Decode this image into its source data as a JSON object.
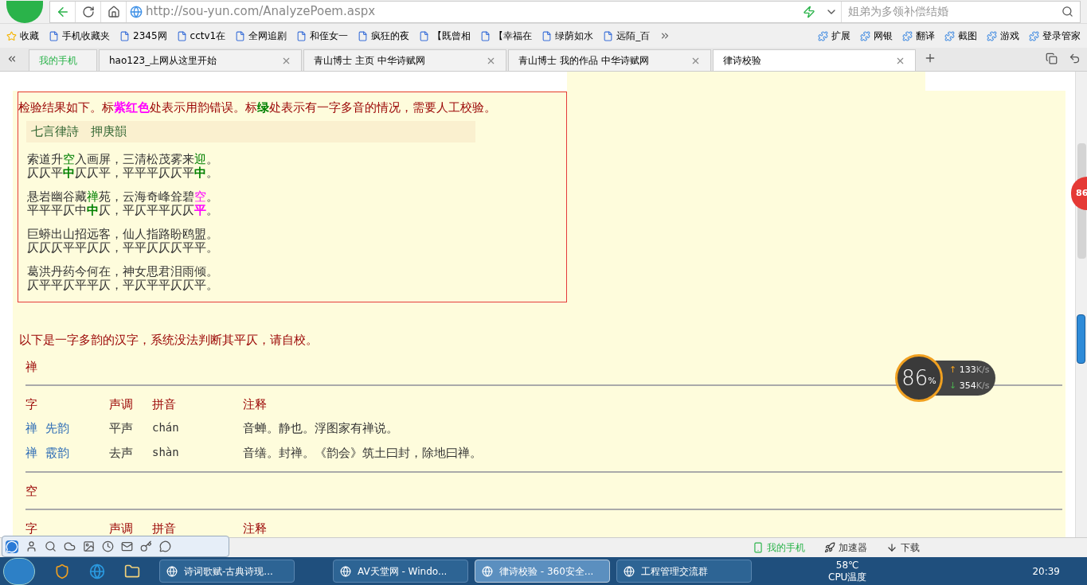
{
  "browser": {
    "url": "http://sou-yun.com/AnalyzePoem.aspx",
    "search_placeholder": "姐弟为多领补偿结婚",
    "bookmarks": [
      {
        "label": "收藏"
      },
      {
        "label": "手机收藏夹"
      },
      {
        "label": "2345网"
      },
      {
        "label": "cctv1在"
      },
      {
        "label": "全网追剧"
      },
      {
        "label": "和侄女一"
      },
      {
        "label": "疯狂的夜"
      },
      {
        "label": "【既曾相"
      },
      {
        "label": "【幸福在"
      },
      {
        "label": "绿荫如水"
      },
      {
        "label": "远陌_百"
      }
    ],
    "tools": [
      {
        "label": "扩展"
      },
      {
        "label": "网银"
      },
      {
        "label": "翻译"
      },
      {
        "label": "截图"
      },
      {
        "label": "游戏"
      },
      {
        "label": "登录管家"
      }
    ],
    "tabs": [
      {
        "label": "我的手机",
        "selected": false
      },
      {
        "label": "hao123_上网从这里开始",
        "selected": false
      },
      {
        "label": "青山博士 主页 中华诗赋网",
        "selected": false
      },
      {
        "label": "青山博士 我的作品 中华诗赋网",
        "selected": false
      },
      {
        "label": "律诗校验",
        "selected": true
      }
    ]
  },
  "result": {
    "intro": [
      {
        "text": "检验结果如下。标",
        "kind": "plain"
      },
      {
        "text": "紫红色",
        "kind": "error"
      },
      {
        "text": "处表示用韵错误。标",
        "kind": "plain"
      },
      {
        "text": "绿",
        "kind": "multi"
      },
      {
        "text": "处表示有一字多音的情况，需要人工校验。",
        "kind": "plain"
      }
    ],
    "form": "七言律詩　押庚韻",
    "couplets": [
      {
        "verse": [
          {
            "text": "索道升",
            "kind": "plain"
          },
          {
            "text": "空",
            "kind": "multi"
          },
          {
            "text": "入画屏，三清松茂雾来",
            "kind": "plain"
          },
          {
            "text": "迎",
            "kind": "multi"
          },
          {
            "text": "。",
            "kind": "plain"
          }
        ],
        "tones": [
          {
            "text": "仄仄平",
            "kind": "plain"
          },
          {
            "text": "中",
            "kind": "multi"
          },
          {
            "text": "仄仄平，平平平仄仄平",
            "kind": "plain"
          },
          {
            "text": "中",
            "kind": "multi"
          },
          {
            "text": "。",
            "kind": "plain"
          }
        ]
      },
      {
        "verse": [
          {
            "text": "悬岩幽谷藏",
            "kind": "plain"
          },
          {
            "text": "禅",
            "kind": "multi"
          },
          {
            "text": "苑，云海奇峰耸碧",
            "kind": "plain"
          },
          {
            "text": "空",
            "kind": "error"
          },
          {
            "text": "。",
            "kind": "plain"
          }
        ],
        "tones": [
          {
            "text": "平平平仄中",
            "kind": "plain"
          },
          {
            "text": "中",
            "kind": "multi"
          },
          {
            "text": "仄，平仄平平仄仄",
            "kind": "plain"
          },
          {
            "text": "平",
            "kind": "error"
          },
          {
            "text": "。",
            "kind": "plain"
          }
        ]
      },
      {
        "verse": [
          {
            "text": "巨蟒出山招远客，仙人指路盼鸥盟。",
            "kind": "plain"
          }
        ],
        "tones": [
          {
            "text": "仄仄仄平平仄仄，平平仄仄仄平平。",
            "kind": "plain"
          }
        ]
      },
      {
        "verse": [
          {
            "text": "葛洪丹药今何在，神女思君泪雨倾。",
            "kind": "plain"
          }
        ],
        "tones": [
          {
            "text": "仄平平仄平平仄，平仄平平仄仄平。",
            "kind": "plain"
          }
        ]
      }
    ]
  },
  "polyphones": {
    "note": "以下是一字多韵的汉字，系统没法判断其平仄，请自校。",
    "groups": [
      {
        "char": "禅",
        "columns": [
          "字",
          "声调",
          "拼音",
          "注释"
        ],
        "rows": [
          [
            "禅  先韵",
            "平声",
            "chán",
            "音蝉。静也。浮图家有禅说。"
          ],
          [
            "禅  霰韵",
            "去声",
            "shàn",
            "音缮。封禅。《韵会》筑土曰封，除地曰禅。"
          ]
        ]
      },
      {
        "char": "空",
        "columns": [
          "字",
          "声调",
          "拼音",
          "注释"
        ]
      }
    ]
  },
  "net_meter": {
    "percent": "86",
    "unit": "%",
    "up_arrow": "↑",
    "up": "133",
    "up_unit": "K/s",
    "down_arrow": "↓",
    "down": "354",
    "down_unit": "K/s"
  },
  "side_badge": "86",
  "status_bar": [
    {
      "label": "我的手机"
    },
    {
      "label": "加速器"
    },
    {
      "label": "下载"
    }
  ],
  "taskbar": {
    "windows": [
      {
        "label": "诗词歌赋-古典诗现...",
        "selected": false
      },
      {
        "label": "AV天堂网 - Windo...",
        "selected": false
      },
      {
        "label": "律诗校验 - 360安全...",
        "selected": true
      },
      {
        "label": "工程管理交流群",
        "selected": false
      }
    ],
    "temp": "58℃",
    "temp_label": "CPU温度",
    "clock": "20:39"
  }
}
